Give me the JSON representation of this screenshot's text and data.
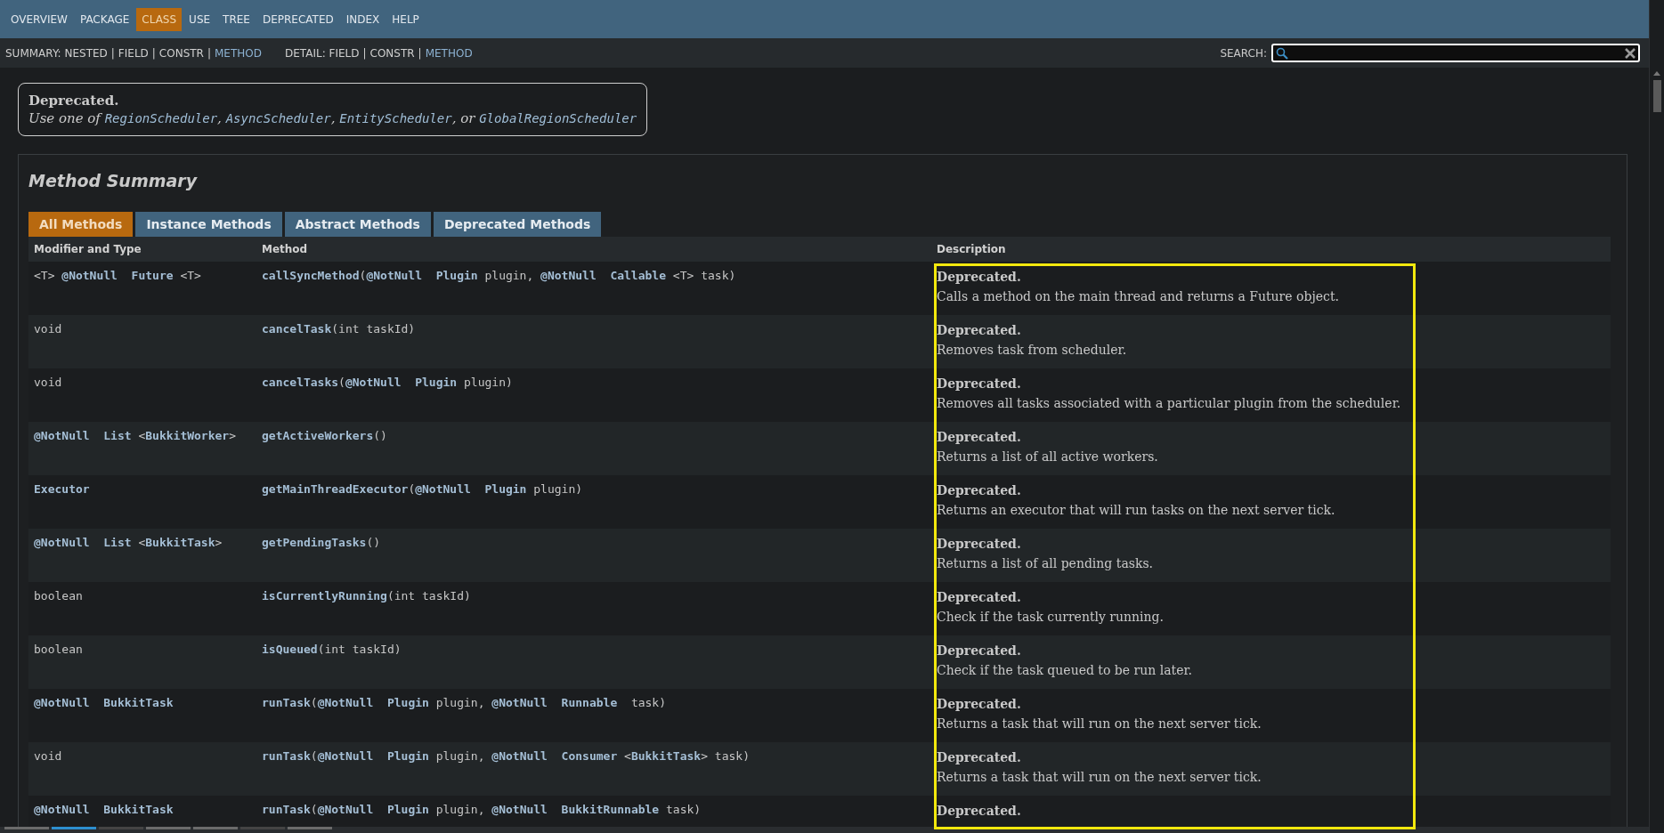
{
  "nav": [
    {
      "label": "OVERVIEW",
      "selected": false
    },
    {
      "label": "PACKAGE",
      "selected": false
    },
    {
      "label": "CLASS",
      "selected": true
    },
    {
      "label": "USE",
      "selected": false
    },
    {
      "label": "TREE",
      "selected": false
    },
    {
      "label": "DEPRECATED",
      "selected": false
    },
    {
      "label": "INDEX",
      "selected": false
    },
    {
      "label": "HELP",
      "selected": false
    }
  ],
  "subnav": {
    "summary": [
      {
        "text": "SUMMARY: NESTED",
        "kind": "plain"
      },
      {
        "text": "|",
        "kind": "separator"
      },
      {
        "text": "FIELD",
        "kind": "plain"
      },
      {
        "text": "|",
        "kind": "separator"
      },
      {
        "text": "CONSTR",
        "kind": "plain"
      },
      {
        "text": "|",
        "kind": "separator"
      },
      {
        "text": "METHOD",
        "kind": "link"
      }
    ],
    "detail": [
      {
        "text": "DETAIL: FIELD",
        "kind": "plain"
      },
      {
        "text": "|",
        "kind": "separator"
      },
      {
        "text": "CONSTR",
        "kind": "plain"
      },
      {
        "text": "|",
        "kind": "separator"
      },
      {
        "text": "METHOD",
        "kind": "link"
      }
    ],
    "search_label": "SEARCH:"
  },
  "deprecation": {
    "title": "Deprecated.",
    "parts": [
      {
        "text": "Use one of ",
        "kind": "plain"
      },
      {
        "text": "RegionScheduler",
        "kind": "link"
      },
      {
        "text": ", ",
        "kind": "plain"
      },
      {
        "text": "AsyncScheduler",
        "kind": "link"
      },
      {
        "text": ", ",
        "kind": "plain"
      },
      {
        "text": "EntityScheduler",
        "kind": "link"
      },
      {
        "text": ", or ",
        "kind": "plain"
      },
      {
        "text": "GlobalRegionScheduler",
        "kind": "link"
      }
    ]
  },
  "method_summary": {
    "title": "Method Summary",
    "tabs": [
      {
        "label": "All Methods",
        "selected": true
      },
      {
        "label": "Instance Methods",
        "selected": false
      },
      {
        "label": "Abstract Methods",
        "selected": false
      },
      {
        "label": "Deprecated Methods",
        "selected": false
      }
    ],
    "columns": [
      "Modifier and Type",
      "Method",
      "Description"
    ],
    "rows": [
      {
        "modifier": "<T> **@NotNull**  **Future** <T>",
        "method": "**callSyncMethod**(**@NotNull**  **Plugin** plugin, **@NotNull**  **Callable** <T> task)",
        "deprecated": "Deprecated.",
        "description": "Calls a method on the main thread and returns a Future object."
      },
      {
        "modifier": "void",
        "method": "**cancelTask**(int taskId)",
        "deprecated": "Deprecated.",
        "description": "Removes task from scheduler."
      },
      {
        "modifier": "void",
        "method": "**cancelTasks**(**@NotNull**  **Plugin** plugin)",
        "deprecated": "Deprecated.",
        "description": "Removes all tasks associated with a particular plugin from the scheduler."
      },
      {
        "modifier": "**@NotNull**  **List** <**BukkitWorker**>",
        "method": "**getActiveWorkers**()",
        "deprecated": "Deprecated.",
        "description": "Returns a list of all active workers."
      },
      {
        "modifier": "**Executor**",
        "method": "**getMainThreadExecutor**(**@NotNull**  **Plugin** plugin)",
        "deprecated": "Deprecated.",
        "description": "Returns an executor that will run tasks on the next server tick."
      },
      {
        "modifier": "**@NotNull**  **List** <**BukkitTask**>",
        "method": "**getPendingTasks**()",
        "deprecated": "Deprecated.",
        "description": "Returns a list of all pending tasks."
      },
      {
        "modifier": "boolean",
        "method": "**isCurrentlyRunning**(int taskId)",
        "deprecated": "Deprecated.",
        "description": "Check if the task currently running."
      },
      {
        "modifier": "boolean",
        "method": "**isQueued**(int taskId)",
        "deprecated": "Deprecated.",
        "description": "Check if the task queued to be run later."
      },
      {
        "modifier": "**@NotNull**  **BukkitTask**",
        "method": "**runTask**(**@NotNull**  **Plugin** plugin, **@NotNull**  **Runnable**  task)",
        "deprecated": "Deprecated.",
        "description": "Returns a task that will run on the next server tick."
      },
      {
        "modifier": "void",
        "method": "**runTask**(**@NotNull**  **Plugin** plugin, **@NotNull**  **Consumer** <**BukkitTask**> task)",
        "deprecated": "Deprecated.",
        "description": "Returns a task that will run on the next server tick."
      },
      {
        "modifier": "**@NotNull**  **BukkitTask**",
        "method": "**runTask**(**@NotNull**  **Plugin** plugin, **@NotNull**  **BukkitRunnable** task)",
        "deprecated": "Deprecated."
      }
    ]
  }
}
